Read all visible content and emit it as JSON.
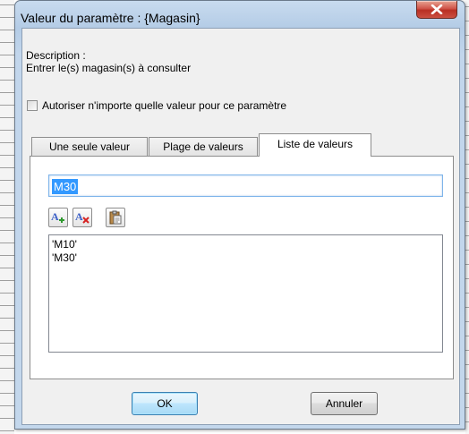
{
  "window": {
    "title": "Valeur du paramètre : {Magasin}",
    "close_label": "X"
  },
  "description": {
    "label": "Description :",
    "text": "Entrer le(s) magasin(s) à consulter"
  },
  "allow_any": {
    "label": "Autoriser n'importe quelle valeur pour ce paramètre",
    "checked": false
  },
  "tabs": [
    {
      "label": "Une seule valeur",
      "selected": false
    },
    {
      "label": "Plage de valeurs",
      "selected": false
    },
    {
      "label": "Liste de valeurs",
      "selected": true
    }
  ],
  "value_input": {
    "value": "M30"
  },
  "toolbar": {
    "add_icon": "add-value-icon",
    "remove_icon": "remove-value-icon",
    "paste_icon": "paste-clipboard-icon"
  },
  "values_list": [
    "'M10'",
    "'M30'"
  ],
  "buttons": {
    "ok": "OK",
    "cancel": "Annuler"
  }
}
